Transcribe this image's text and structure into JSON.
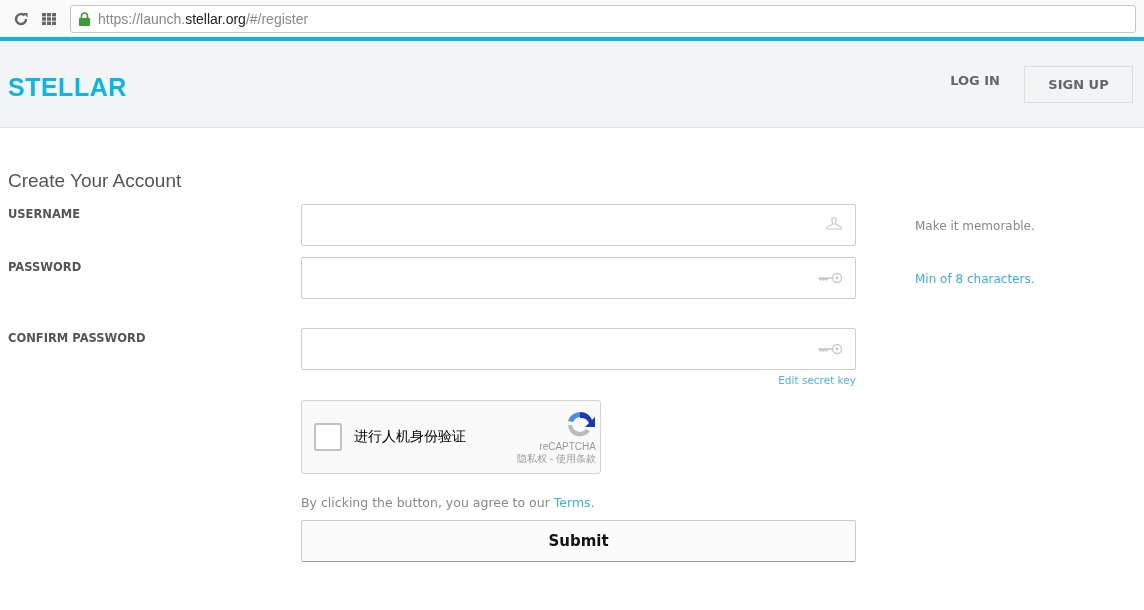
{
  "browser": {
    "url": [
      {
        "text": "https://launch.",
        "emphasis": false
      },
      {
        "text": "stellar.org",
        "emphasis": true
      },
      {
        "text": "/#/register",
        "emphasis": false
      }
    ],
    "secure": true
  },
  "header": {
    "logo": "STELLAR",
    "login": "LOG IN",
    "signup": "SIGN UP"
  },
  "form": {
    "title": "Create Your Account",
    "fields": [
      {
        "label": "USERNAME",
        "kind": "username",
        "hint": "Make it memorable."
      },
      {
        "label": "PASSWORD",
        "kind": "password",
        "hint": "Min of 8 characters."
      },
      {
        "label": "CONFIRM PASSWORD",
        "kind": "password",
        "link": "Edit secret key"
      }
    ],
    "captcha": {
      "checked": false,
      "label": "进行人机身份验证",
      "brand": "reCAPTCHA",
      "footer": "隐私权 - 使用条款"
    },
    "terms": {
      "prefix": "By clicking the button, you agree to our ",
      "link": "Terms",
      "suffix": "."
    },
    "submit": "Submit"
  }
}
